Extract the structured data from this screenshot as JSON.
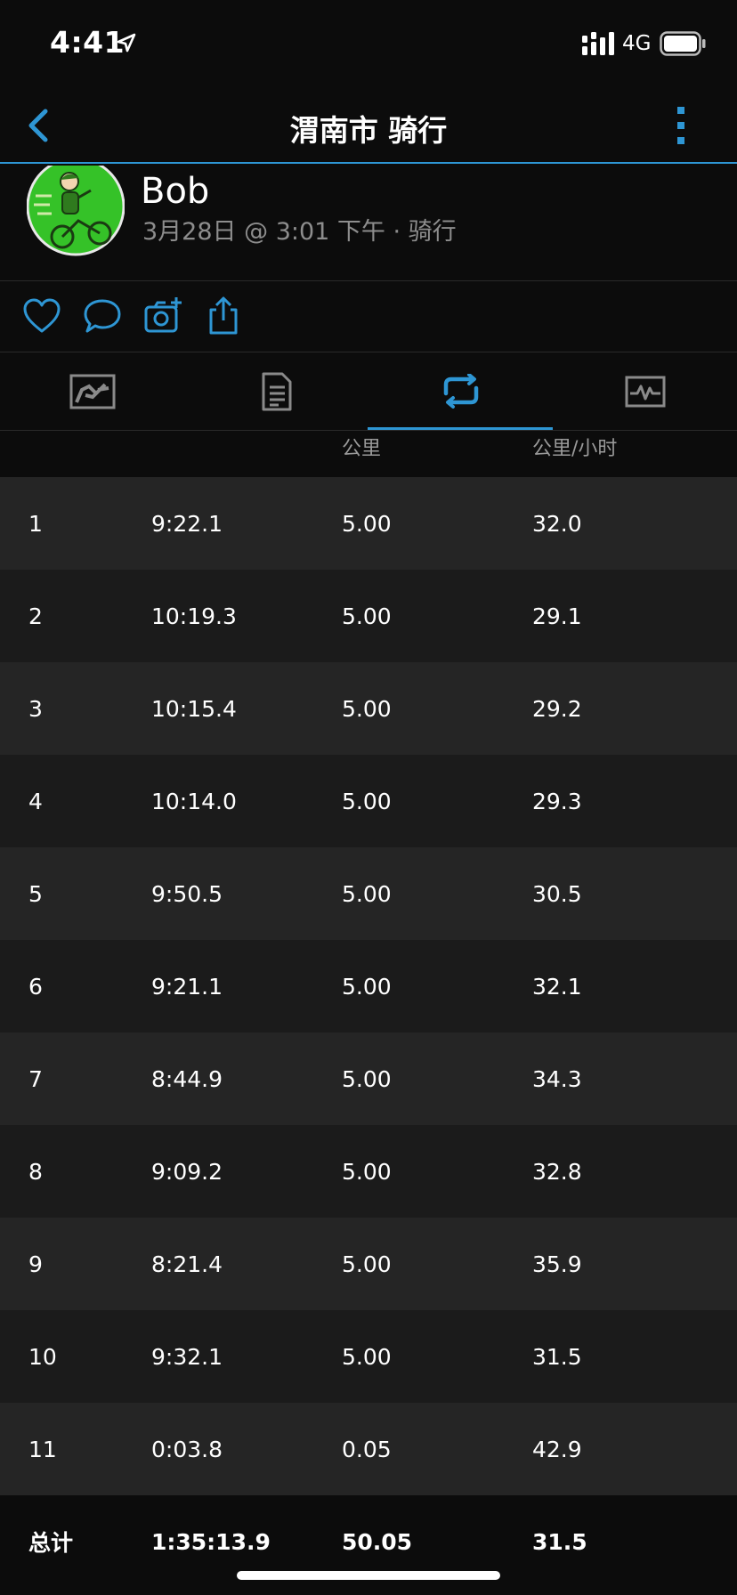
{
  "status_bar": {
    "time": "4:41",
    "network": "4G"
  },
  "nav": {
    "title": "渭南市 骑行"
  },
  "profile": {
    "name": "Bob",
    "meta": "3月28日 @ 3:01 下午 · 骑行"
  },
  "icons": {
    "back": "back-chevron-icon",
    "more": "more-vertical-icon",
    "like": "heart-icon",
    "comment": "comment-icon",
    "photo": "add-photo-icon",
    "share": "share-icon",
    "tabs": [
      "overview-chart-icon",
      "details-document-icon",
      "laps-loop-icon",
      "performance-graph-icon"
    ]
  },
  "colors": {
    "accent": "#2e96d4",
    "background": "#0c0c0c",
    "row_odd": "#252525",
    "row_even": "#1b1b1b",
    "muted": "#8d8d8d"
  },
  "table": {
    "headers": {
      "distance": "公里",
      "speed": "公里/小时"
    },
    "laps": [
      {
        "lap": "1",
        "time": "9:22.1",
        "distance": "5.00",
        "speed": "32.0"
      },
      {
        "lap": "2",
        "time": "10:19.3",
        "distance": "5.00",
        "speed": "29.1"
      },
      {
        "lap": "3",
        "time": "10:15.4",
        "distance": "5.00",
        "speed": "29.2"
      },
      {
        "lap": "4",
        "time": "10:14.0",
        "distance": "5.00",
        "speed": "29.3"
      },
      {
        "lap": "5",
        "time": "9:50.5",
        "distance": "5.00",
        "speed": "30.5"
      },
      {
        "lap": "6",
        "time": "9:21.1",
        "distance": "5.00",
        "speed": "32.1"
      },
      {
        "lap": "7",
        "time": "8:44.9",
        "distance": "5.00",
        "speed": "34.3"
      },
      {
        "lap": "8",
        "time": "9:09.2",
        "distance": "5.00",
        "speed": "32.8"
      },
      {
        "lap": "9",
        "time": "8:21.4",
        "distance": "5.00",
        "speed": "35.9"
      },
      {
        "lap": "10",
        "time": "9:32.1",
        "distance": "5.00",
        "speed": "31.5"
      },
      {
        "lap": "11",
        "time": "0:03.8",
        "distance": "0.05",
        "speed": "42.9"
      }
    ],
    "total": {
      "label": "总计",
      "time": "1:35:13.9",
      "distance": "50.05",
      "speed": "31.5"
    }
  }
}
